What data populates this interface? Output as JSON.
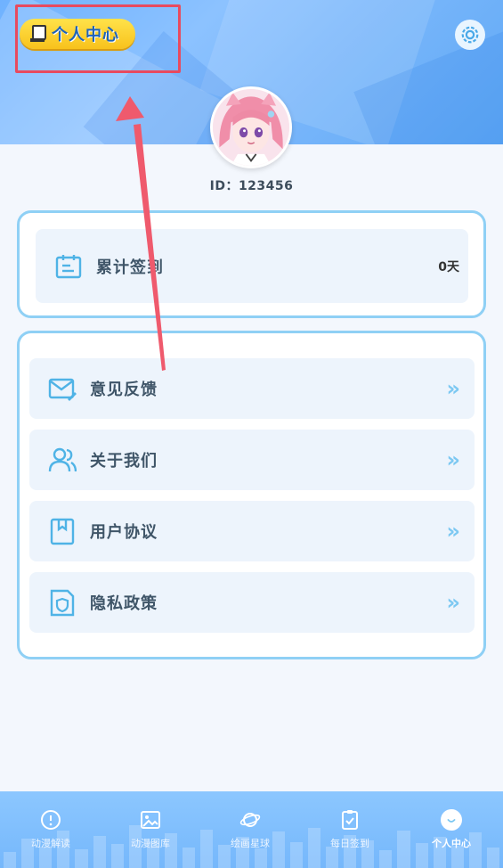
{
  "header": {
    "title": "个人中心",
    "icons": {
      "left": "trophy-icon",
      "right": "settings-icon"
    }
  },
  "profile": {
    "id_text": "ID：123456",
    "avatar": "anime-girl-avatar"
  },
  "signin": {
    "label": "累计签到",
    "value": "0天",
    "icon": "calendar-icon"
  },
  "menu": {
    "items": [
      {
        "label": "意见反馈",
        "icon": "mail-edit-icon"
      },
      {
        "label": "关于我们",
        "icon": "users-icon"
      },
      {
        "label": "用户协议",
        "icon": "bookmark-doc-icon"
      },
      {
        "label": "隐私政策",
        "icon": "shield-doc-icon"
      }
    ],
    "chevron": "»"
  },
  "bottom_nav": {
    "items": [
      {
        "label": "动漫解读",
        "icon": "info-icon"
      },
      {
        "label": "动漫图库",
        "icon": "image-icon"
      },
      {
        "label": "绘画星球",
        "icon": "planet-icon"
      },
      {
        "label": "每日签到",
        "icon": "clipboard-check-icon"
      },
      {
        "label": "个人中心",
        "icon": "profile-icon",
        "active": true
      }
    ]
  },
  "colors": {
    "accent": "#7cc8f2",
    "card_border": "#8fd0f5",
    "title_pill": "#f8c21c",
    "annotation": "#e84a5f"
  }
}
